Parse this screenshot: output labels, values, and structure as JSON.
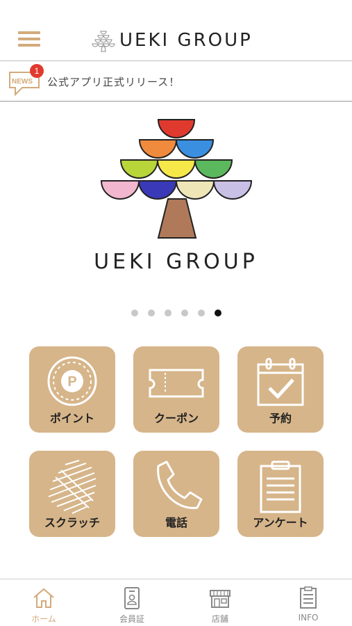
{
  "header": {
    "title": "UEKI GROUP",
    "menu_icon": "hamburger-menu-icon",
    "logo_icon": "tree-logo-icon"
  },
  "news": {
    "icon": "news-icon",
    "badge": "1",
    "text": "公式アプリ正式リリース！"
  },
  "hero": {
    "title": "UEKI GROUP",
    "slides": 6,
    "active_slide": 6
  },
  "tiles": [
    {
      "label": "ポイント",
      "icon": "point-coin-icon"
    },
    {
      "label": "クーポン",
      "icon": "coupon-ticket-icon"
    },
    {
      "label": "予約",
      "icon": "calendar-check-icon"
    },
    {
      "label": "スクラッチ",
      "icon": "scratch-icon"
    },
    {
      "label": "電話",
      "icon": "phone-icon"
    },
    {
      "label": "アンケート",
      "icon": "clipboard-survey-icon"
    }
  ],
  "bottom_nav": [
    {
      "label": "ホーム",
      "icon": "home-icon",
      "active": true
    },
    {
      "label": "会員証",
      "icon": "member-card-icon",
      "active": false
    },
    {
      "label": "店舗",
      "icon": "store-icon",
      "active": false
    },
    {
      "label": "INFO",
      "icon": "info-list-icon",
      "active": false
    }
  ],
  "colors": {
    "accent": "#d2aa7a",
    "tile_bg": "#d6b58a",
    "badge": "#e03a2f",
    "tree_colors": [
      "#e03a2f",
      "#f08a3c",
      "#3a8fe0",
      "#b8d63a",
      "#f7e84a",
      "#5cb85c",
      "#f3b6cf",
      "#3a3ab8",
      "#efe6b8",
      "#c9c0e6"
    ]
  }
}
